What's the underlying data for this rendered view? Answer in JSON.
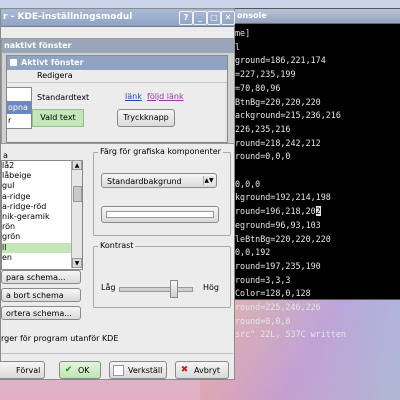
{
  "konsole": {
    "title": "onsole",
    "lines": [
      "me]",
      "l",
      "ground=186,221,174",
      "=227,235,199",
      "=70,80,96",
      "BtnBg=220,220,220",
      "ackground=215,236,216",
      "226,235,216",
      "round=218,242,212",
      "round=0,0,0",
      "",
      "0,0,0",
      "kground=192,214,198",
      "round=196,218,20",
      "eground=96,93,103",
      "leBtnBg=220,220,220",
      "0,0,192",
      "round=197,235,190",
      "round=3,3,3",
      "Color=128,0,128",
      "round=225,246,226",
      "round=0,0,0",
      "src\" 22L, 537C written"
    ],
    "cursor_char": "2"
  },
  "window": {
    "title": "r - KDE-inställningsmodul",
    "controls": [
      "?",
      "_",
      "▢",
      "✕"
    ]
  },
  "preview": {
    "inactive_title": "naktivt fönster",
    "active_title": "Aktivt fönster",
    "menu_item": "Redigera",
    "side_items": [
      "",
      "opna",
      "r"
    ],
    "standard_text": "Standardtext",
    "link": "länk",
    "visited_link": "följd länk",
    "selected_text": "Vald text",
    "push_button": "Tryckknapp"
  },
  "schema": {
    "label": "a",
    "items": [
      "lå2",
      "låbeige",
      "gul",
      "a-ridge",
      "a-ridge-röd",
      "nik-geramik",
      "rön",
      "grön",
      "ll",
      "en"
    ],
    "selected_index": 8,
    "buttons": [
      "para schema...",
      "a bort schema",
      "ortera schema..."
    ]
  },
  "colors_group": {
    "title": "Färg för grafiska komponenter",
    "component": "Standardbakgrund",
    "swatch": "#ffffff"
  },
  "contrast": {
    "title": "Kontrast",
    "low": "Låg",
    "high": "Hög",
    "value_fraction": 0.75
  },
  "apply_kde": "rger för program utanför KDE",
  "buttons": {
    "defaults": "Förval",
    "ok": "OK",
    "apply": "Verkställ",
    "cancel": "Avbryt"
  },
  "accent": "#c3e7b8"
}
